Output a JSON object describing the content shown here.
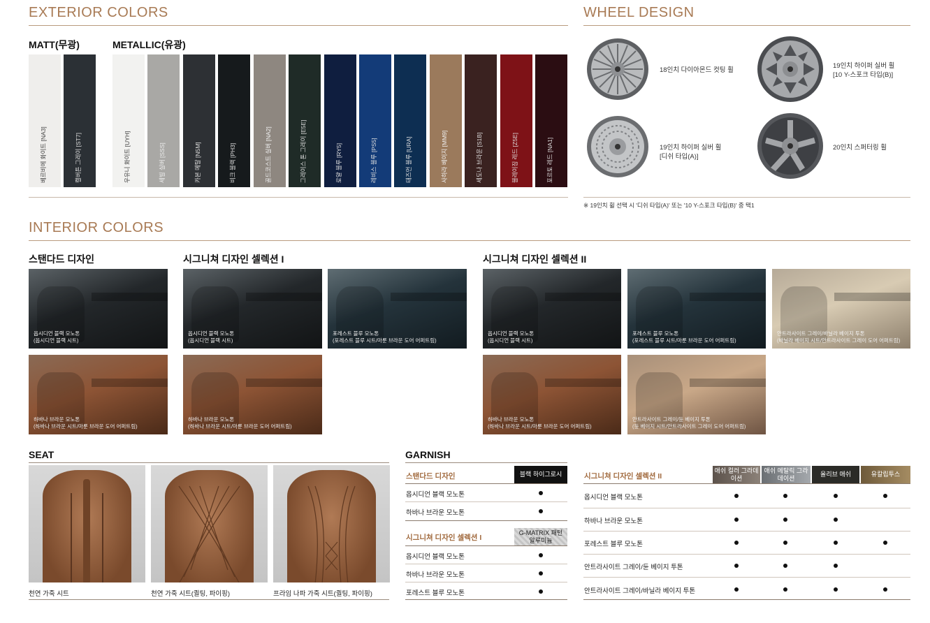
{
  "exterior": {
    "title": "EXTERIOR COLORS",
    "matt_label": "MATT(무광)",
    "metallic_label": "METALLIC(유광)",
    "swatches": [
      {
        "name": "베르비에 화이트 [NA3]",
        "color": "#efeeec",
        "text_color": "#444444"
      },
      {
        "name": "캘버튼 그레이 [ST7]",
        "color": "#2b3035",
        "text_color": "#dddddd"
      },
      {
        "name": "우유니 화이트 [UYH]",
        "color": "#f2f2f0",
        "text_color": "#444444"
      },
      {
        "name": "세빌 실버 [SSS]",
        "color": "#a9a8a5",
        "text_color": "#eeeeee"
      },
      {
        "name": "카본 메탈 [N5M]",
        "color": "#2d3034",
        "text_color": "#dddddd"
      },
      {
        "name": "비크 블랙 [PH3]",
        "color": "#161a1c",
        "text_color": "#dddddd"
      },
      {
        "name": "골드코스트 실버 [NA2]",
        "color": "#8e8780",
        "text_color": "#eeeeee"
      },
      {
        "name": "그레이스 톤 그레이 [E5E]",
        "color": "#1f2b27",
        "text_color": "#dddddd"
      },
      {
        "name": "로얄 블루 [RY5]",
        "color": "#0f1e3f",
        "text_color": "#dddddd"
      },
      {
        "name": "레비스 블루 [PS5]",
        "color": "#133b78",
        "text_color": "#dddddd"
      },
      {
        "name": "태즈먼 블루 [URA]",
        "color": "#0d2e52",
        "text_color": "#dddddd"
      },
      {
        "name": "사하라 베이지 [MM9]",
        "color": "#9b7a5c",
        "text_color": "#f0f0f0"
      },
      {
        "name": "세도나 브라운 [S1B]",
        "color": "#3a2220",
        "text_color": "#dddddd"
      },
      {
        "name": "블레이징 레드 [Z5E]",
        "color": "#7e1217",
        "text_color": "#dddddd"
      },
      {
        "name": "포르토 레드 [NA1]",
        "color": "#2b0d12",
        "text_color": "#dddddd"
      }
    ]
  },
  "wheel": {
    "title": "WHEEL DESIGN",
    "items": [
      {
        "label": "18인치 다이아몬드 컷팅 휠",
        "label2": "",
        "icon": "wheel-18-diamond-cut-icon"
      },
      {
        "label": "19인치 하이퍼 실버 휠",
        "label2": "[10 Y-스포크 타입(B)]",
        "icon": "wheel-19-y-spoke-icon"
      },
      {
        "label": "19인치 하이퍼 실버 휠",
        "label2": "[디쉬 타입(A)]",
        "icon": "wheel-19-dish-icon"
      },
      {
        "label": "20인치 스퍼터링 휠",
        "label2": "",
        "icon": "wheel-20-sputtering-icon"
      }
    ],
    "note": "※ 19인치 휠 선택 시 '디쉬 타입(A)' 또는 '10 Y-스포크 타입(B)' 중 택1"
  },
  "interior": {
    "title": "INTERIOR COLORS",
    "standard_label": "스탠다드 디자인",
    "sig1_label": "시그니쳐 디자인 셀렉션 I",
    "sig2_label": "시그니쳐 디자인 셀렉션 II",
    "photos": [
      {
        "line1": "옵시디언 블랙 모노톤",
        "line2": "(옵시디언 블랙 시트)",
        "tone": "dark"
      },
      {
        "line1": "하바나 브라운 모노톤",
        "line2": "(하바나 브라운 시트/마룬 브라운 도어 어퍼트림)",
        "tone": "brown"
      },
      {
        "line1": "옵시디언 블랙 모노톤",
        "line2": "(옵시디언 블랙 시트)",
        "tone": "dark"
      },
      {
        "line1": "포레스트 블루 모노톤",
        "line2": "(포레스트 블루 시트/마룬 브라운 도어 어퍼트림)",
        "tone": "blue"
      },
      {
        "line1": "하바나 브라운 모노톤",
        "line2": "(하바나 브라운 시트/마룬 브라운 도어 어퍼트림)",
        "tone": "brown"
      },
      {
        "line1": "옵시디언 블랙 모노톤",
        "line2": "(옵시디언 블랙 시트)",
        "tone": "dark"
      },
      {
        "line1": "포레스트 블루 모노톤",
        "line2": "(포레스트 블루 시트/마룬 브라운 도어 어퍼트림)",
        "tone": "blue"
      },
      {
        "line1": "안트라사이트 그레이/바닐라 베이지 투톤",
        "line2": "(바닐라 베이지 시트/안트라사이트 그레이 도어 어퍼트림)",
        "tone": "beige"
      },
      {
        "line1": "하바나 브라운 모노톤",
        "line2": "(하바나 브라운 시트/마룬 브라운 도어 어퍼트림)",
        "tone": "brown"
      },
      {
        "line1": "안트라사이트 그레이/듄 베이지 투톤",
        "line2": "(듄 베이지 시트/안트라사이트 그레이 도어 어퍼트림)",
        "tone": "dune"
      }
    ]
  },
  "seat": {
    "title": "SEAT",
    "items": [
      {
        "label": "천연 가죽 시트"
      },
      {
        "label": "천연 가죽 시트(퀼팅, 파이핑)"
      },
      {
        "label": "프라임 나파 가죽 시트(퀼팅, 파이핑)"
      }
    ]
  },
  "garnish": {
    "title": "GARNISH",
    "standard": {
      "label": "스탠다드 디자인",
      "header": "블랙 하이그로시",
      "rows": [
        "옵시디언 블랙 모노톤",
        "하바나 브라운 모노톤"
      ]
    },
    "sig1": {
      "label": "시그니쳐 디자인 셀렉션 I",
      "header": "G-MATRIX 패턴 알루미늄",
      "rows": [
        "옵시디언 블랙 모노톤",
        "하바나 브라운 모노톤",
        "포레스트 블루 모노톤"
      ]
    },
    "sig2": {
      "label": "시그니쳐 디자인 셀렉션 II",
      "headers": [
        "애쉬 컬러 그라데이션",
        "애쉬 메탈릭 그라데이션",
        "올리브 애쉬",
        "유칼립투스"
      ],
      "rows": [
        {
          "name": "옵시디언 블랙 모노톤",
          "marks": [
            true,
            true,
            true,
            true
          ]
        },
        {
          "name": "하바나 브라운 모노톤",
          "marks": [
            true,
            true,
            true,
            false
          ]
        },
        {
          "name": "포레스트 블루 모노톤",
          "marks": [
            true,
            true,
            true,
            true
          ]
        },
        {
          "name": "안트라사이트 그레이/듄 베이지 투톤",
          "marks": [
            true,
            true,
            true,
            false
          ]
        },
        {
          "name": "안트라사이트 그레이/바닐라 베이지 투톤",
          "marks": [
            true,
            true,
            true,
            true
          ]
        }
      ]
    },
    "mark": "●"
  }
}
